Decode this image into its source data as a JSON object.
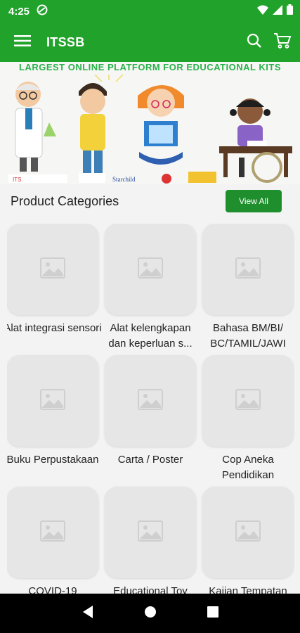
{
  "status_bar": {
    "time": "4:25",
    "icons": [
      "do-not-disturb-icon",
      "wifi-icon",
      "signal-icon",
      "battery-icon"
    ]
  },
  "app_bar": {
    "title": "ITSSB",
    "icons": [
      "menu-icon",
      "search-icon",
      "cart-icon"
    ]
  },
  "banner": {
    "tagline": "LARGEST ONLINE PLATFORM FOR EDUCATIONAL KITS"
  },
  "categories": {
    "title": "Product Categories",
    "view_all_label": "View All",
    "items": [
      {
        "label": "Alat integrasi sensori"
      },
      {
        "label": "Alat kelengkapan dan keperluan s..."
      },
      {
        "label": "Bahasa BM/BI/ BC/TAMIL/JAWI"
      },
      {
        "label": "Buku Perpustakaan"
      },
      {
        "label": "Carta / Poster"
      },
      {
        "label": "Cop Aneka Pendidikan"
      },
      {
        "label": "COVID-19"
      },
      {
        "label": "Educational Toy"
      },
      {
        "label": "Kajian Tempatan"
      }
    ]
  },
  "colors": {
    "primary": "#21a32b",
    "button": "#1f8f2e",
    "placeholder": "#e6e6e6"
  },
  "nav_bar": {
    "icons": [
      "back-icon",
      "home-icon",
      "recents-icon"
    ]
  }
}
